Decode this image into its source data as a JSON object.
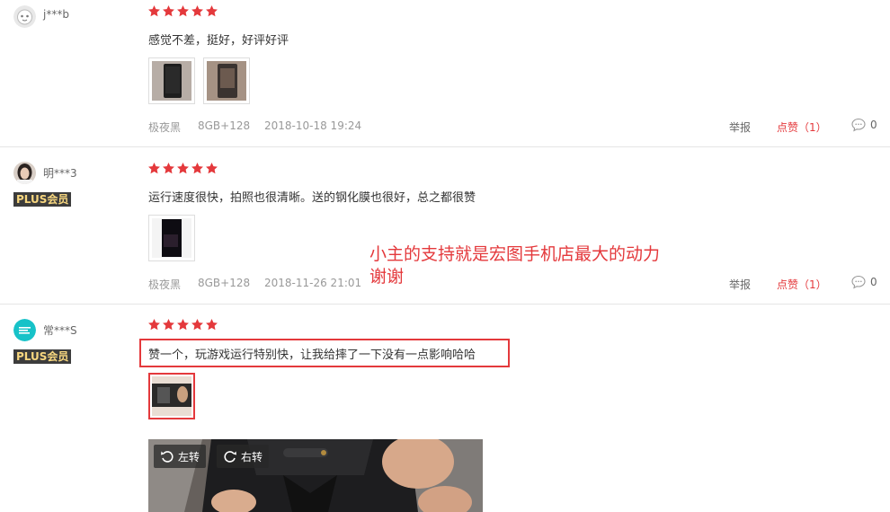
{
  "reviews": [
    {
      "username": "j***b",
      "plus_badge": "",
      "rating": 5,
      "content": "感觉不差，挺好，好评好评",
      "color": "极夜黑",
      "spec": "8GB+128",
      "date": "2018-10-18 19:24",
      "report_label": "举报",
      "like_label": "点赞（1）",
      "comment_count": "0"
    },
    {
      "username": "明***3",
      "plus_badge": "PLUS会员",
      "rating": 5,
      "content": "运行速度很快，拍照也很清晰。送的钢化膜也很好，总之都很赞",
      "color": "极夜黑",
      "spec": "8GB+128",
      "date": "2018-11-26 21:01",
      "report_label": "举报",
      "like_label": "点赞（1）",
      "comment_count": "0"
    },
    {
      "username": "常***S",
      "plus_badge": "PLUS会员",
      "rating": 5,
      "content": "赞一个，玩游戏运行特别快，让我给摔了一下没有一点影响哈哈",
      "rotate_left_label": "左转",
      "rotate_right_label": "右转"
    }
  ],
  "annotation": {
    "line1": "小主的支持就是宏图手机店最大的动力",
    "line2": "谢谢"
  },
  "colors": {
    "star": "#e4393c",
    "accent": "#e4393c",
    "plus_badge_bg": "#3c3c3c",
    "plus_badge_text": "#f8d77f"
  }
}
